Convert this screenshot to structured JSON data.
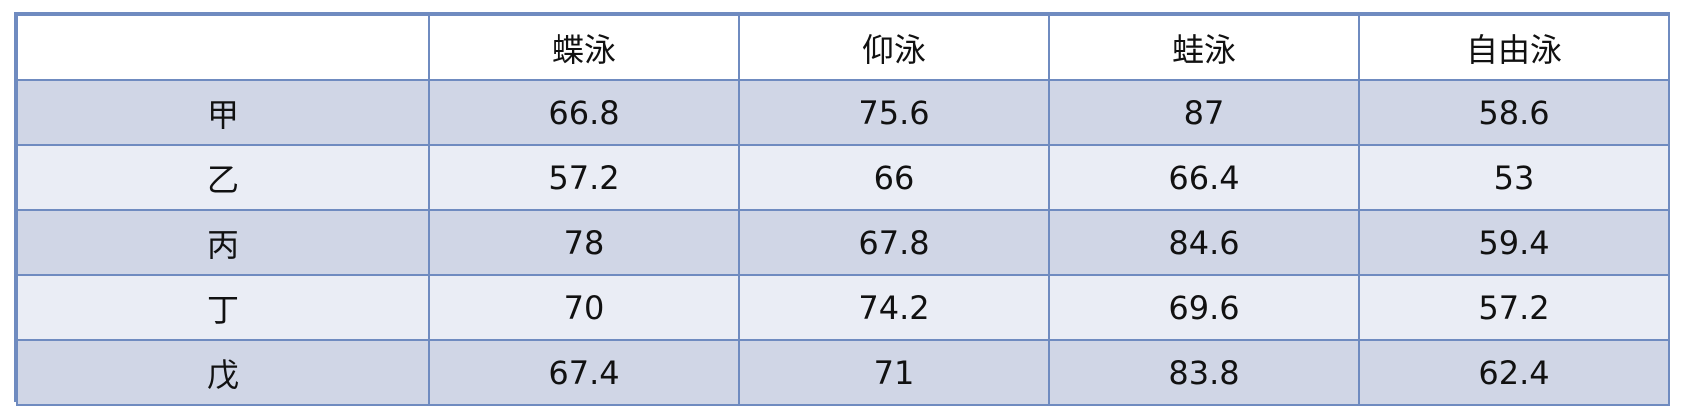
{
  "table": {
    "corner": "",
    "columns": [
      "蝶泳",
      "仰泳",
      "蛙泳",
      "自由泳"
    ],
    "rows": [
      {
        "label": "甲",
        "values": [
          "66.8",
          "75.6",
          "87",
          "58.6"
        ]
      },
      {
        "label": "乙",
        "values": [
          "57.2",
          "66",
          "66.4",
          "53"
        ]
      },
      {
        "label": "丙",
        "values": [
          "78",
          "67.8",
          "84.6",
          "59.4"
        ]
      },
      {
        "label": "丁",
        "values": [
          "70",
          "74.2",
          "69.6",
          "57.2"
        ]
      },
      {
        "label": "戊",
        "values": [
          "67.4",
          "71",
          "83.8",
          "62.4"
        ]
      }
    ]
  },
  "colors": {
    "border": "#6f8bc0",
    "row_band_dark": "#d0d6e6",
    "row_band_light": "#eaedf5",
    "header_bg": "#ffffff"
  }
}
